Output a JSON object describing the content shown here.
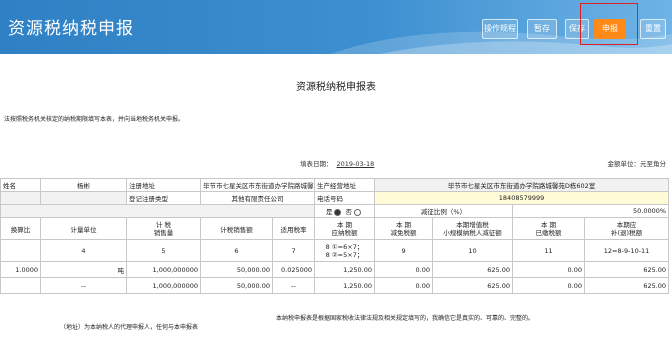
{
  "header": {
    "title": "资源税纳税申报",
    "buttons": [
      {
        "label": "操作规程"
      },
      {
        "label": "暂存"
      },
      {
        "label": "保存"
      },
      {
        "label": "申报"
      },
      {
        "label": "重置"
      }
    ]
  },
  "form": {
    "title": "资源税纳税申报表",
    "note": "法按照税务机关核定的纳税期限填写本表，并向当地税务机关申报。",
    "date_label": "填表日期：",
    "date_value": "2019-03-18",
    "unit": "金额单位：元至角分"
  },
  "info": {
    "row1": {
      "c0": "姓名",
      "c1": "杨彬",
      "c2": "注册地址",
      "c3": "毕节市七星关区市东街道办学院路城馨苑D栋602室",
      "c4": "生产经营地址",
      "c5": "毕节市七星关区市东街道办学院路城馨苑D栋602室"
    },
    "row2": {
      "c2": "登记注册类型",
      "c3": "其他有限责任公司",
      "c4": "电话号码",
      "c5": "18408579999"
    },
    "row3": {
      "yes": "是",
      "no": "否",
      "reduction_label": "减征比例（%）",
      "reduction_value": "50.0000%"
    }
  },
  "table": {
    "headers": [
      "换算比",
      "计量单位",
      "计 税\n销售量",
      "计税销售额",
      "适用税率",
      "本 期\n应纳税额",
      "本 期\n减免税额",
      "本期增值税\n小规模纳税人减征额",
      "本 期\n已缴税额",
      "本期应\n补(退)税额"
    ],
    "index": [
      "",
      "4",
      "5",
      "6",
      "7",
      "8 ①=6×7；\n8 ②=5×7；",
      "9",
      "10",
      "11",
      "12=8-9-10-11"
    ],
    "rows": [
      [
        "1.0000",
        "吨",
        "1,000,000000",
        "50,000.00",
        "0.025000",
        "1,250.00",
        "0.00",
        "625.00",
        "0.00",
        "625.00"
      ],
      [
        "",
        "--",
        "1,000,000000",
        "50,000.00",
        "--",
        "1,250.00",
        "0.00",
        "625.00",
        "0.00",
        "625.00"
      ]
    ]
  },
  "footer": {
    "left": "（地址）为本纳税人的代理申报人，任何与本申报表",
    "right": "本纳税申报表是根据国家税收法律法规及相关规定填写的，我确信它是真实的、可靠的、完整的。"
  }
}
